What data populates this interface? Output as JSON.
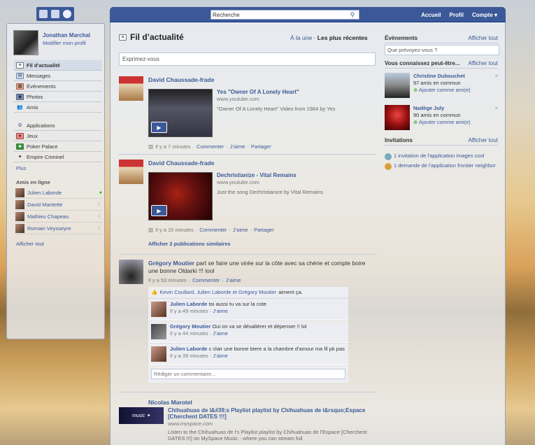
{
  "topbar": {
    "search_placeholder": "Recherche",
    "search_value": "Recherche",
    "nav": [
      "Accueil",
      "Profil",
      "Compte ▾"
    ]
  },
  "profile": {
    "name": "Jonathan Marchal",
    "edit": "Modifier mon profil"
  },
  "sidebar": {
    "items": [
      {
        "label": "Fil d’actualité",
        "icon": "news-feed-icon",
        "selected": true
      },
      {
        "label": "Messages",
        "icon": "messages-icon"
      },
      {
        "label": "Évènements",
        "icon": "events-icon"
      },
      {
        "label": "Photos",
        "icon": "photos-icon"
      },
      {
        "label": "Amis",
        "icon": "friends-icon"
      }
    ],
    "apps": [
      {
        "label": "Applications",
        "icon": "applications-icon"
      },
      {
        "label": "Jeux",
        "icon": "games-icon"
      },
      {
        "label": "Poker Palace",
        "icon": "poker-palace-icon"
      },
      {
        "label": "Empire Criminel",
        "icon": "empire-criminel-icon"
      }
    ],
    "more": "Plus",
    "online_title": "Amis en ligne",
    "online": [
      {
        "name": "Julien Laborde",
        "status": "●"
      },
      {
        "name": "David Mantette",
        "status": "☾"
      },
      {
        "name": "Mathieu Chapeau",
        "status": "☾"
      },
      {
        "name": "Romain Veysseyre",
        "status": "☾"
      }
    ],
    "show_all": "Afficher tout"
  },
  "feed": {
    "title": "Fil d’actualité",
    "tab_top": "À la une",
    "tab_sep": "·",
    "tab_recent": "Les plus récentes",
    "composer_placeholder": "Exprimez-vous",
    "stories": [
      {
        "author": "David Chaussade-frade",
        "video_title": "Yes \"Owner Of A Lonely Heart\"",
        "video_source": "www.youtube.com",
        "video_desc": "\"Owner Of A Lonely Heart\" Video from 1984 by Yes",
        "time": "Il y a 7 minutes",
        "comment": "Commenter",
        "like": "J’aime",
        "share": "Partager"
      },
      {
        "author": "David Chaussade-frade",
        "video_title": "Dechristianize - Vital Remains",
        "video_source": "www.youtube.com",
        "video_desc": "Just the song Dechristianize by Vital Remains",
        "time": "Il y a 15 minutes",
        "comment": "Commenter",
        "like": "J’aime",
        "share": "Partager"
      }
    ],
    "similar": "Afficher 2 publications similaires",
    "status_story": {
      "author": "Grégory Moutier",
      "message": "part se faire une virée sur la côte avec sa chérie et compte boire une bonne Oldarki !!! lool",
      "time": "Il y a 53 minutes",
      "comment": "Commenter",
      "like": "J’aime",
      "likes_text": "Kevin Coullard, Julien Laborde et Grégory Moutier",
      "likes_suffix": "aiment ça.",
      "comments": [
        {
          "name": "Julien Laborde",
          "text": "toi aussi tu va sur la cote",
          "time": "Il y a 49 minutes",
          "like": "J’aime"
        },
        {
          "name": "Grégory Moutier",
          "text": "Oui on va se désaltérer et dépenser !! lol",
          "time": "Il y a 44 minutes",
          "like": "J’aime"
        },
        {
          "name": "Julien Laborde",
          "text": "c clair une bonne biere a la chambre d'amour ma fil pk pas",
          "time": "Il y a 39 minutes",
          "like": "J’aime"
        }
      ],
      "write_placeholder": "Rédiger un commentaire..."
    },
    "music_story": {
      "author": "Nicolas Marotel",
      "title": "Chihuahuas de l&#39;s Playlist playlist by Chihuahuas de l&rsquo;Espace [Cherchent DATES !!!]",
      "source": "www.myspace.com",
      "desc": "Listen to the Chihuahuas de l's Playlist playlist by Chihuahuas de l'Espace [Cherchent DATES !!!] on MySpace Music - where you can stream full"
    }
  },
  "right": {
    "events_title": "Évènements",
    "events_all": "Afficher tout",
    "events_placeholder": "Que prévoyez-vous ?",
    "pymk_title": "Vous connaissez peut-être...",
    "pymk_all": "Afficher tout",
    "suggestions": [
      {
        "name": "Christine Dubouchet",
        "mutual": "97 amis en commun",
        "add": "Ajouter comme ami(e)"
      },
      {
        "name": "Nadège July",
        "mutual": "90 amis en commun",
        "add": "Ajouter comme ami(e)"
      }
    ],
    "inv_title": "Invitations",
    "inv_all": "Afficher tout",
    "invitations": [
      "1 invitation de l'application images cool",
      "1 demande de l'application frontier neighbor"
    ]
  }
}
